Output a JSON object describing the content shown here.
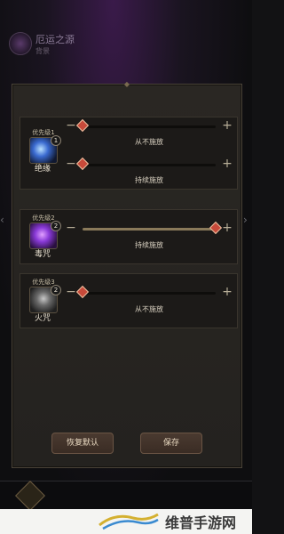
{
  "header": {
    "title": "厄运之源",
    "subtitle": "背景"
  },
  "rows": [
    {
      "priority": "优先级1",
      "skill_name": "绝缘",
      "skill_num": "1",
      "icon_color": "#4a7ad8",
      "sliders": [
        {
          "label": "从不施放",
          "level": 0.0
        },
        {
          "label": "持续施放",
          "level": 0.0
        }
      ]
    },
    {
      "priority": "优先级2",
      "skill_name": "毒咒",
      "skill_num": "2",
      "icon_color": "#8a3ad8",
      "sliders": [
        {
          "label": "持续施放",
          "level": 1.0
        }
      ]
    },
    {
      "priority": "优先级3",
      "skill_name": "火咒",
      "skill_num": "2",
      "icon_color": "#6a6a6a",
      "sliders": [
        {
          "label": "从不施放",
          "level": 0.0
        }
      ]
    }
  ],
  "buttons": {
    "reset": "恢复默认",
    "save": "保存"
  },
  "watermark": {
    "text": "维普手游网"
  },
  "colors": {
    "accent": "#c84a3a",
    "panel": "#2a2723",
    "button": "#4a3a30"
  }
}
